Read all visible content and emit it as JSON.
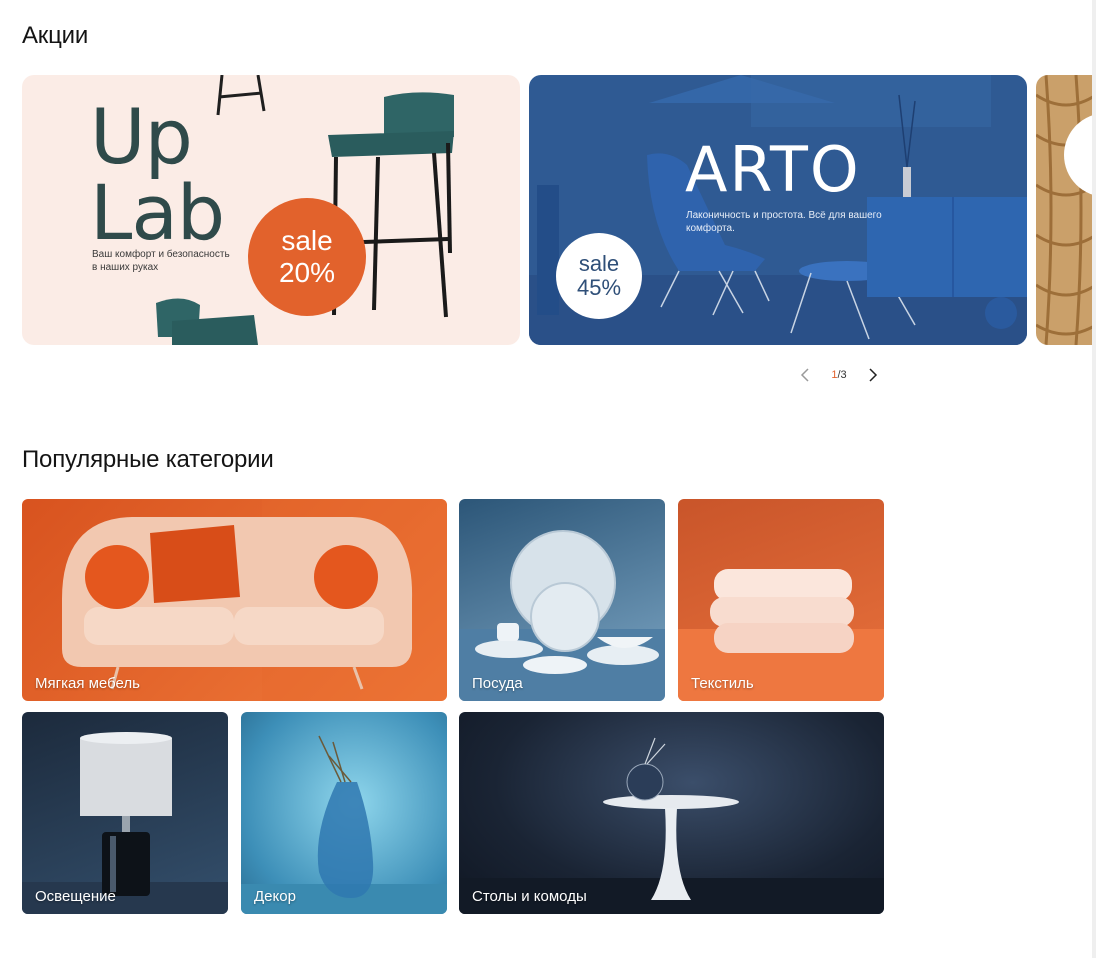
{
  "promo": {
    "title": "Акции",
    "banners": [
      {
        "brand_line1": "Up",
        "brand_line2": "Lab",
        "subtitle": "Ваш комфорт и безопасность в наших руках",
        "sale_label": "sale",
        "sale_value": "20%",
        "colors": {
          "background": "#fbece6",
          "accent": "#e2622c",
          "brand": "#2f4a4a"
        }
      },
      {
        "brand": "ARTO",
        "subtitle": "Лаконичность и простота. Всё для вашего комфорта.",
        "sale_label": "sale",
        "sale_value": "45%",
        "colors": {
          "background": "#2f5a93",
          "badge": "#ffffff"
        }
      }
    ],
    "pager": {
      "current": "1",
      "separator": "/",
      "total": "3",
      "prev_icon": "chevron-left-icon",
      "next_icon": "chevron-right-icon"
    }
  },
  "categories": {
    "title": "Популярные категории",
    "items": [
      {
        "label": "Мягкая мебель"
      },
      {
        "label": "Посуда"
      },
      {
        "label": "Текстиль"
      },
      {
        "label": "Освещение"
      },
      {
        "label": "Декор"
      },
      {
        "label": "Столы и комоды"
      }
    ]
  }
}
